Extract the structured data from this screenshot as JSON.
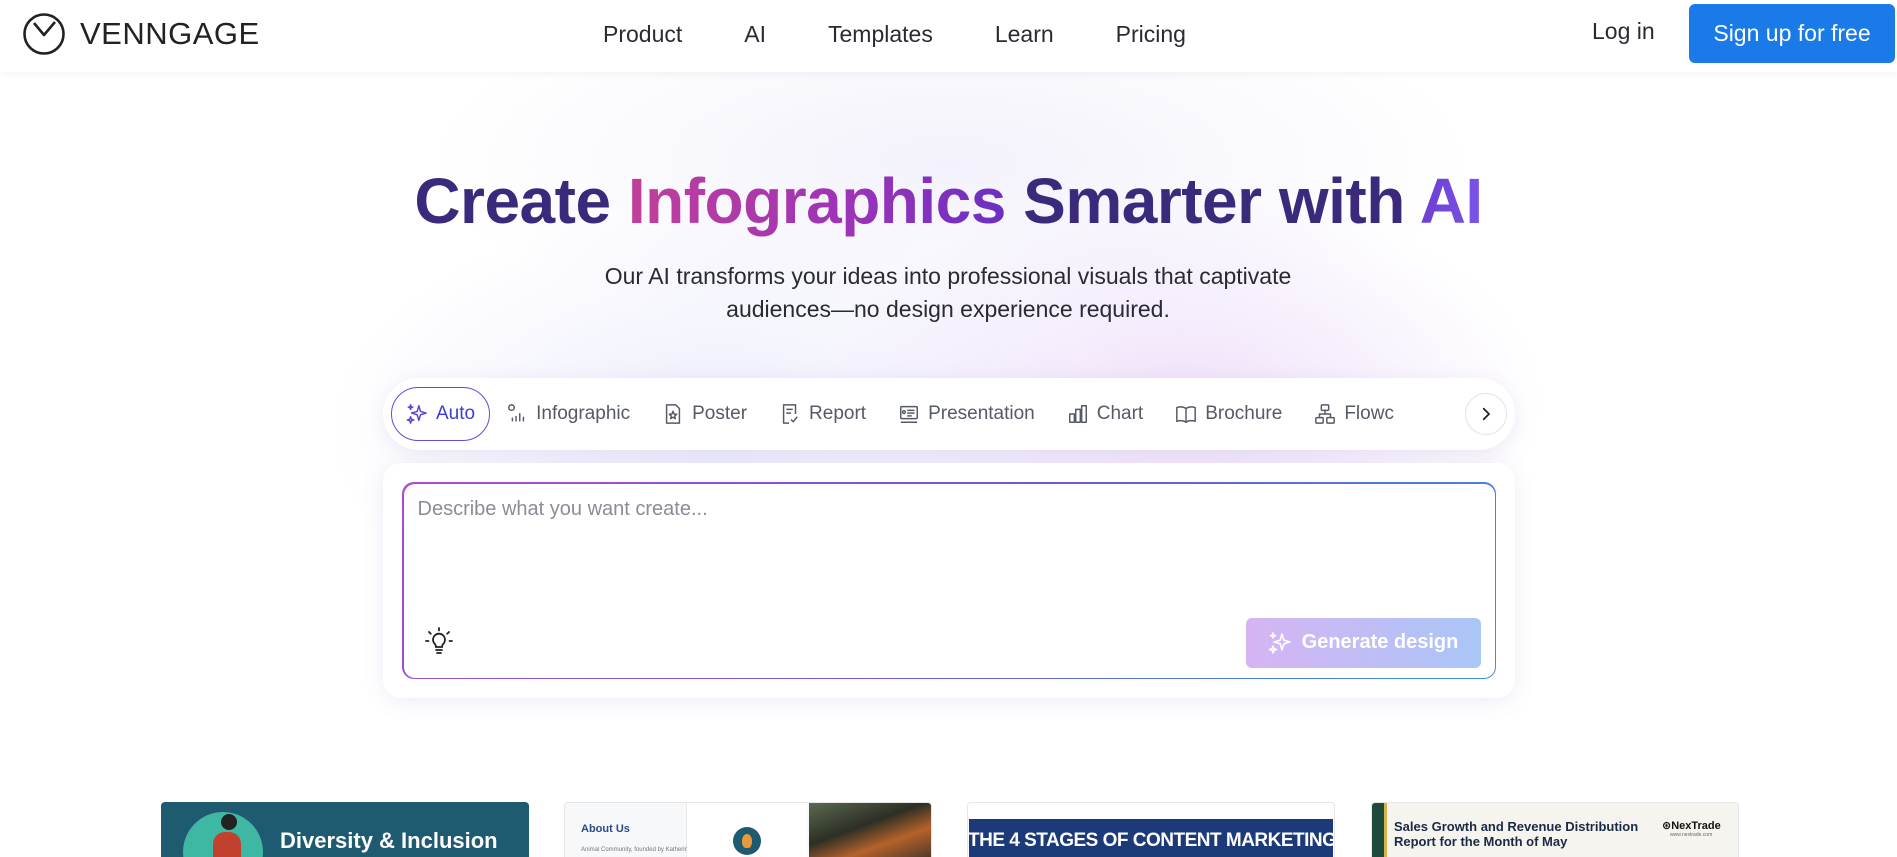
{
  "header": {
    "brand": "VENNGAGE",
    "nav": [
      "Product",
      "AI",
      "Templates",
      "Learn",
      "Pricing"
    ],
    "login": "Log in",
    "signup": "Sign up for free"
  },
  "hero": {
    "title_part1": "Create ",
    "title_highlight1": "Infographics",
    "title_part2": " Smarter with ",
    "title_highlight2": "AI",
    "subtitle_line1": "Our AI transforms your ideas into professional visuals that captivate",
    "subtitle_line2": "audiences—no design experience required."
  },
  "tabs": {
    "active": "Auto",
    "items": [
      {
        "label": "Auto",
        "icon": "sparkles-icon"
      },
      {
        "label": "Infographic",
        "icon": "infographic-icon"
      },
      {
        "label": "Poster",
        "icon": "poster-icon"
      },
      {
        "label": "Report",
        "icon": "report-icon"
      },
      {
        "label": "Presentation",
        "icon": "presentation-icon"
      },
      {
        "label": "Chart",
        "icon": "bar-chart-icon"
      },
      {
        "label": "Brochure",
        "icon": "book-icon"
      },
      {
        "label": "Flowc",
        "icon": "flowchart-icon"
      }
    ]
  },
  "prompt": {
    "placeholder": "Describe what you want create...",
    "value": "",
    "generate_label": "Generate design"
  },
  "templates": {
    "t1_title": "Diversity & Inclusion",
    "t2_heading": "About Us",
    "t2_line": "Animal Community, founded by Katherine",
    "t3_title": "THE 4 STAGES OF CONTENT MARKETING",
    "t4_title": "Sales Growth and Revenue Distribution Report for the Month of May",
    "t4_brand": "⊛NexTrade",
    "t4_url": "www.nextrade.com"
  },
  "colors": {
    "primary_button": "#1a7be8",
    "title_color": "#3b2a7c",
    "active_tab_border": "#6a48d8"
  }
}
